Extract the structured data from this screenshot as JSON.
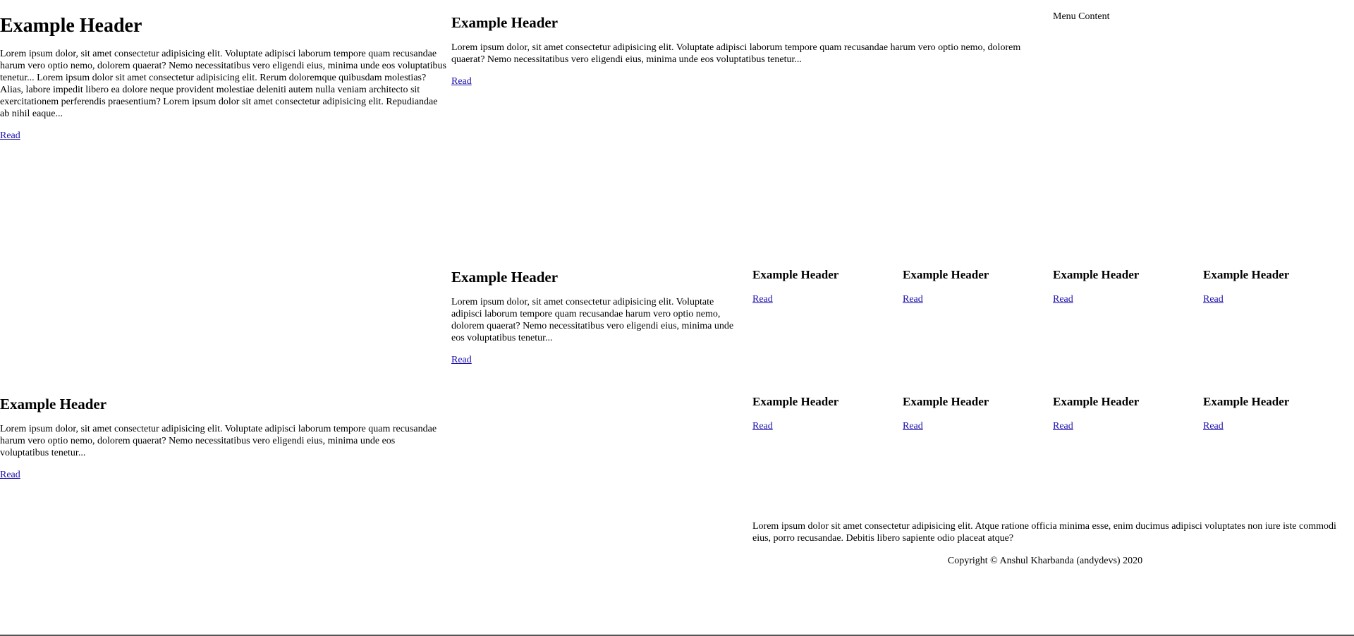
{
  "featured": {
    "title": "Example Header",
    "body": "Lorem ipsum dolor, sit amet consectetur adipisicing elit. Voluptate adipisci laborum tempore quam recusandae harum vero optio nemo, dolorem quaerat? Nemo necessitatibus vero eligendi eius, minima unde eos voluptatibus tenetur... Lorem ipsum dolor sit amet consectetur adipisicing elit. Rerum doloremque quibusdam molestias? Alias, labore impedit libero ea dolore neque provident molestiae deleniti autem nulla veniam architecto sit exercitationem perferendis praesentium? Lorem ipsum dolor sit amet consectetur adipisicing elit. Repudiandae ab nihil eaque...",
    "link": "Read"
  },
  "article_top": {
    "title": "Example Header",
    "body": "Lorem ipsum dolor, sit amet consectetur adipisicing elit. Voluptate adipisci laborum tempore quam recusandae harum vero optio nemo, dolorem quaerat? Nemo necessitatibus vero eligendi eius, minima unde eos voluptatibus tenetur...",
    "link": "Read"
  },
  "menu": {
    "label": "Menu Content"
  },
  "article_mid": {
    "title": "Example Header",
    "body": "Lorem ipsum dolor, sit amet consectetur adipisicing elit. Voluptate adipisci laborum tempore quam recusandae harum vero optio nemo, dolorem quaerat? Nemo necessitatibus vero eligendi eius, minima unde eos voluptatibus tenetur...",
    "link": "Read"
  },
  "article_bottom": {
    "title": "Example Header",
    "body": "Lorem ipsum dolor, sit amet consectetur adipisicing elit. Voluptate adipisci laborum tempore quam recusandae harum vero optio nemo, dolorem quaerat? Nemo necessitatibus vero eligendi eius, minima unde eos voluptatibus tenetur...",
    "link": "Read"
  },
  "cards": [
    {
      "title": "Example Header",
      "link": "Read"
    },
    {
      "title": "Example Header",
      "link": "Read"
    },
    {
      "title": "Example Header",
      "link": "Read"
    },
    {
      "title": "Example Header",
      "link": "Read"
    },
    {
      "title": "Example Header",
      "link": "Read"
    },
    {
      "title": "Example Header",
      "link": "Read"
    },
    {
      "title": "Example Header",
      "link": "Read"
    },
    {
      "title": "Example Header",
      "link": "Read"
    }
  ],
  "footer": {
    "text": "Lorem ipsum dolor sit amet consectetur adipisicing elit. Atque ratione officia minima esse, enim ducimus adipisci voluptates non iure iste commodi eius, porro recusandae. Debitis libero sapiente odio placeat atque?",
    "copyright": "Copyright © Anshul Kharbanda (andydevs) 2020"
  },
  "colors": {
    "link": "#1a0dab",
    "text": "#000000",
    "background": "#ffffff"
  }
}
